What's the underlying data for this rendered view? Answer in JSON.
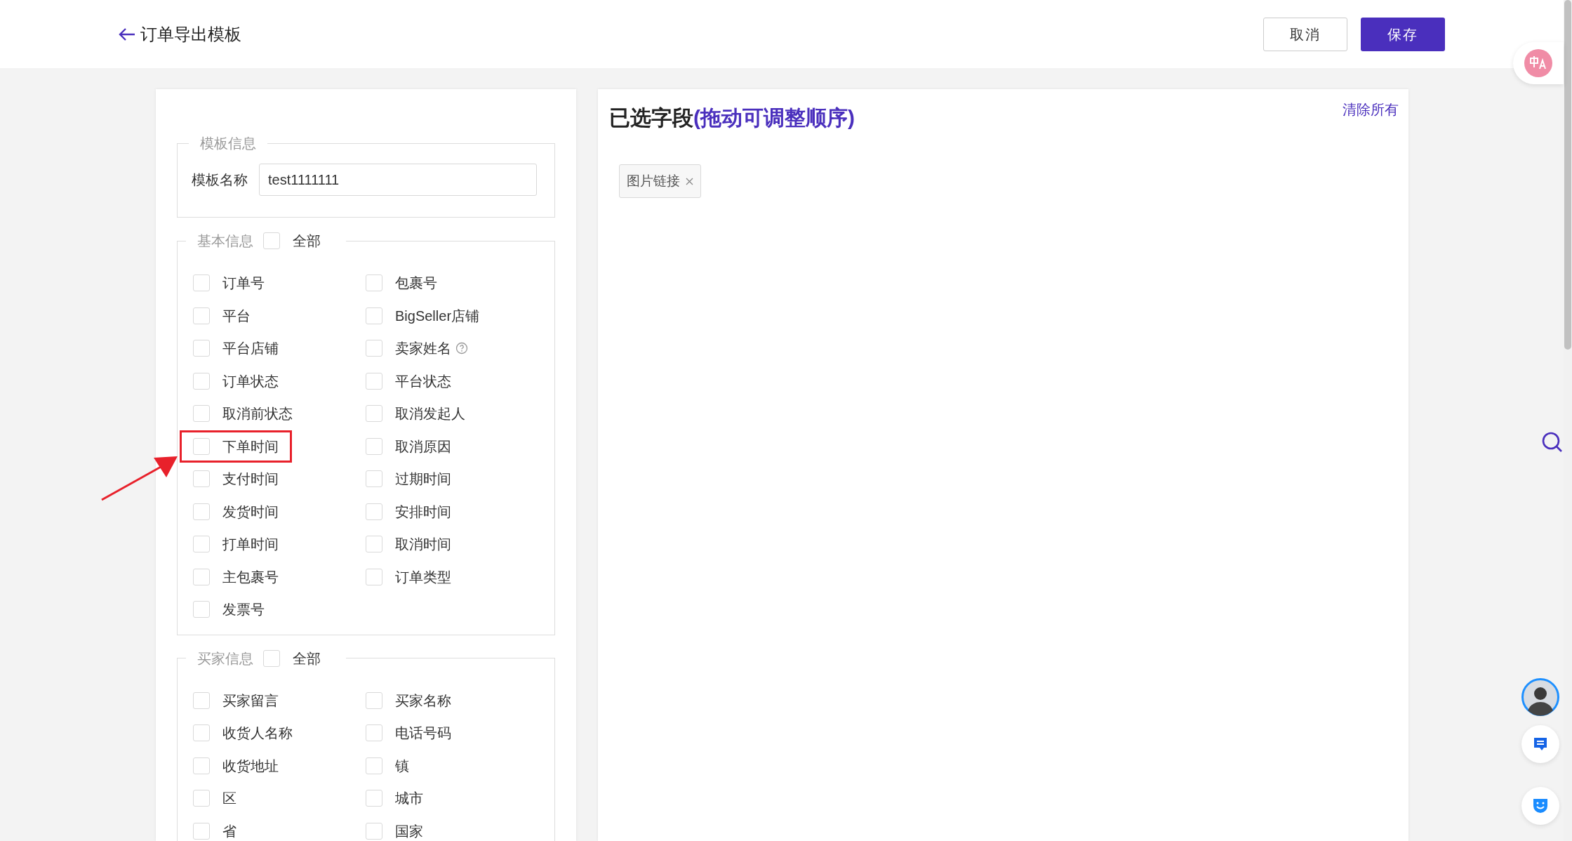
{
  "header": {
    "title": "订单导出模板",
    "buttons": [
      {
        "label": "取消",
        "kind": "secondary"
      },
      {
        "label": "保存",
        "kind": "primary"
      }
    ]
  },
  "template_info": {
    "legend": "模板信息",
    "name_label": "模板名称",
    "name_value": "test1111111"
  },
  "field_groups": [
    {
      "legend": "基本信息",
      "all_label": "全部",
      "all_checked": false,
      "fields": [
        {
          "label": "订单号",
          "checked": false
        },
        {
          "label": "包裹号",
          "checked": false
        },
        {
          "label": "平台",
          "checked": false
        },
        {
          "label": "BigSeller店铺",
          "checked": false
        },
        {
          "label": "平台店铺",
          "checked": false
        },
        {
          "label": "卖家姓名",
          "checked": false,
          "help": true
        },
        {
          "label": "订单状态",
          "checked": false
        },
        {
          "label": "平台状态",
          "checked": false
        },
        {
          "label": "取消前状态",
          "checked": false
        },
        {
          "label": "取消发起人",
          "checked": false
        },
        {
          "label": "下单时间",
          "checked": false,
          "highlighted": true
        },
        {
          "label": "取消原因",
          "checked": false
        },
        {
          "label": "支付时间",
          "checked": false
        },
        {
          "label": "过期时间",
          "checked": false
        },
        {
          "label": "发货时间",
          "checked": false
        },
        {
          "label": "安排时间",
          "checked": false
        },
        {
          "label": "打单时间",
          "checked": false
        },
        {
          "label": "取消时间",
          "checked": false
        },
        {
          "label": "主包裹号",
          "checked": false
        },
        {
          "label": "订单类型",
          "checked": false
        },
        {
          "label": "发票号",
          "checked": false
        }
      ]
    },
    {
      "legend": "买家信息",
      "all_label": "全部",
      "all_checked": false,
      "fields": [
        {
          "label": "买家留言",
          "checked": false
        },
        {
          "label": "买家名称",
          "checked": false
        },
        {
          "label": "收货人名称",
          "checked": false
        },
        {
          "label": "电话号码",
          "checked": false
        },
        {
          "label": "收货地址",
          "checked": false
        },
        {
          "label": "镇",
          "checked": false
        },
        {
          "label": "区",
          "checked": false
        },
        {
          "label": "城市",
          "checked": false
        },
        {
          "label": "省",
          "checked": false
        },
        {
          "label": "国家",
          "checked": false
        }
      ]
    }
  ],
  "selected_panel": {
    "title": "已选字段",
    "hint": "(拖动可调整顺序)",
    "clear_label": "清除所有",
    "tags": [
      "图片链接"
    ]
  }
}
